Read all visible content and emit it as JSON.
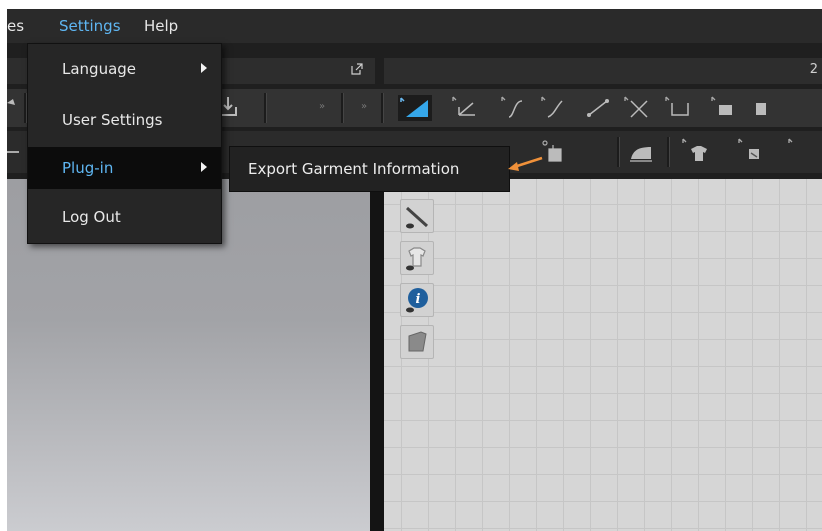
{
  "menubar": {
    "items": [
      {
        "label": "es",
        "active": false
      },
      {
        "label": "Settings",
        "active": true
      },
      {
        "label": "Help",
        "active": false
      }
    ]
  },
  "panel_right": {
    "corner_number": "2"
  },
  "settings_menu": {
    "items": [
      {
        "label": "Language",
        "has_submenu": true,
        "highlighted": false
      },
      {
        "label": "User Settings",
        "has_submenu": false,
        "highlighted": false
      },
      {
        "label": "Plug-in",
        "has_submenu": true,
        "highlighted": true
      },
      {
        "label": "Log Out",
        "has_submenu": false,
        "highlighted": false
      }
    ]
  },
  "plugin_submenu": {
    "items": [
      {
        "label": "Export Garment Information"
      }
    ]
  },
  "colors": {
    "accent": "#5fb6f2",
    "callout_arrow": "#f0913a"
  }
}
